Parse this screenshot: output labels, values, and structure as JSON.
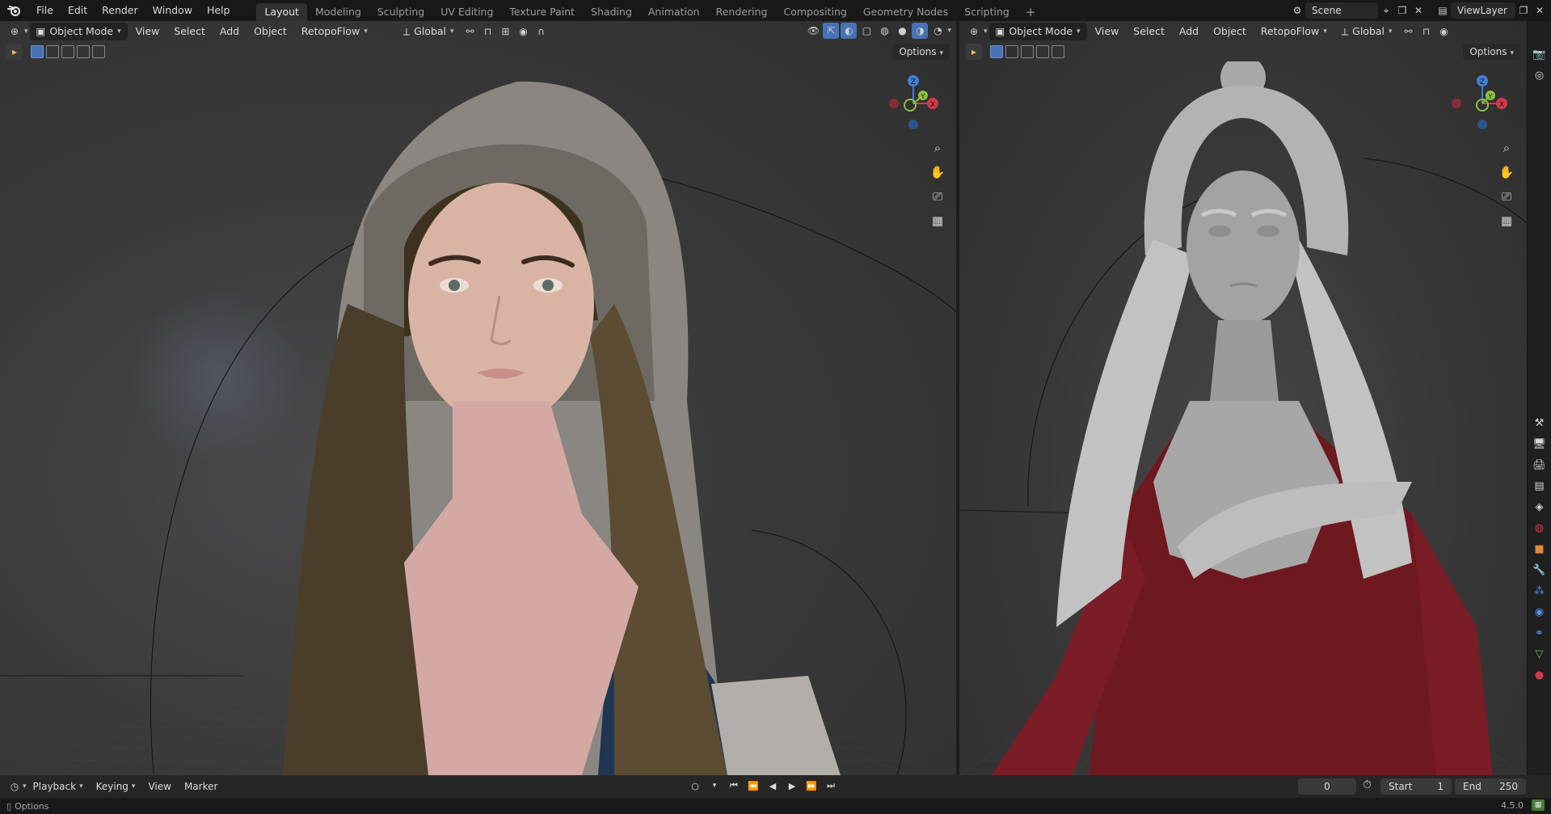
{
  "menu": {
    "items": [
      "File",
      "Edit",
      "Render",
      "Window",
      "Help"
    ]
  },
  "workspaces": {
    "tabs": [
      "Layout",
      "Modeling",
      "Sculpting",
      "UV Editing",
      "Texture Paint",
      "Shading",
      "Animation",
      "Rendering",
      "Compositing",
      "Geometry Nodes",
      "Scripting"
    ],
    "active": "Layout",
    "add_label": "+"
  },
  "topright": {
    "scene_label": "Scene",
    "viewlayer_label": "ViewLayer"
  },
  "viewport_left": {
    "mode": "Object Mode",
    "menus": [
      "View",
      "Select",
      "Add",
      "Object"
    ],
    "addon": "RetopoFlow",
    "orientation": "Global",
    "options": "Options"
  },
  "viewport_right": {
    "mode": "Object Mode",
    "menus": [
      "View",
      "Select",
      "Add",
      "Object"
    ],
    "addon": "RetopoFlow",
    "orientation": "Global",
    "options": "Options"
  },
  "gizmo_labels": {
    "z": "Z",
    "y": "Y",
    "x": "X"
  },
  "timeline": {
    "menus": [
      "Playback",
      "Keying",
      "View",
      "Marker"
    ],
    "current_frame": "0",
    "start_label": "Start",
    "start_value": "1",
    "end_label": "End",
    "end_value": "250"
  },
  "status": {
    "left_text": "Options",
    "version": "4.5.0"
  },
  "colors": {
    "accent": "#4772b3",
    "axis_x": "#d4384a",
    "axis_y": "#8ac33e",
    "axis_z": "#3f7fd6"
  }
}
